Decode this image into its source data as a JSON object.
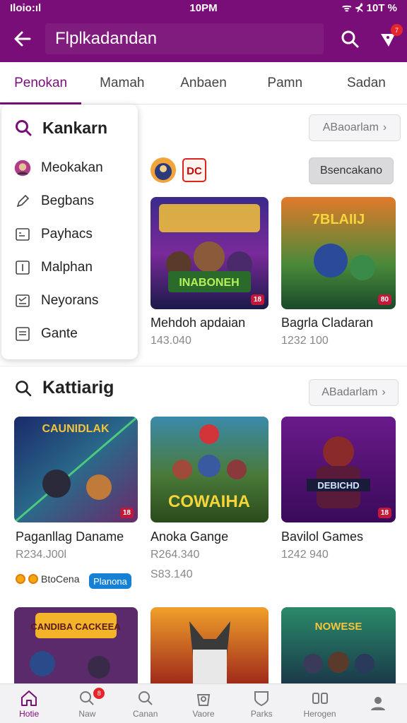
{
  "status_bar": {
    "left": "Iloio:ıl",
    "time": "10PM",
    "right": "ᯤ ⊀ 10T %"
  },
  "app_bar": {
    "title": "Flplkadandan",
    "cart_count": "7"
  },
  "tabs": [
    {
      "label": "Penokan",
      "active": true
    },
    {
      "label": "Mamah"
    },
    {
      "label": "Anbaen"
    },
    {
      "label": "Pamn"
    },
    {
      "label": "Sadan"
    }
  ],
  "dropdown": {
    "header": "Kankarn",
    "items": [
      {
        "label": "Meokakan",
        "icon": "avatar-icon"
      },
      {
        "label": "Begbans",
        "icon": "pencil-icon"
      },
      {
        "label": "Payhacs",
        "icon": "card-icon"
      },
      {
        "label": "Malphan",
        "icon": "bracket-icon"
      },
      {
        "label": "Neyorans",
        "icon": "checklist-icon"
      },
      {
        "label": "Gante",
        "icon": "document-icon"
      }
    ]
  },
  "top_section": {
    "see_all": "ABaoarlam",
    "action_button": "Bsencakano",
    "games": [
      {
        "name": "Mehdoh apdaian",
        "count": "143.040",
        "rating": "18",
        "art_text": "INABONEH"
      },
      {
        "name": "Bagrla Cladaran",
        "count": "1232 100",
        "rating": "80",
        "art_text": "7BLAIIJ"
      }
    ]
  },
  "section2": {
    "title": "Kattiarig",
    "see_all": "ABadarlam",
    "games": [
      {
        "name": "Paganllag Daname",
        "count": "R234.J00l",
        "rating": "18",
        "art_text": "CAUNIDLAK"
      },
      {
        "name": "Anoka Gange",
        "count": "R264.340",
        "count2": "S83.140",
        "art_text": "COWAIHA"
      },
      {
        "name": "Bavilol Games",
        "count": "1242 940",
        "rating": "18",
        "art_text": "DEBICHD"
      }
    ],
    "coin_text": "BtoCena",
    "tag": "Planona"
  },
  "third_row": [
    {
      "art_text": "CANDIBA CACKEEA"
    },
    {
      "art_text": ""
    },
    {
      "art_text": "NOWESE"
    }
  ],
  "bottom_nav": [
    {
      "label": "Hotie",
      "icon": "home-icon",
      "active": true
    },
    {
      "label": "Naw",
      "icon": "search-badge-icon",
      "badge": "8"
    },
    {
      "label": "Canan",
      "icon": "search-icon"
    },
    {
      "label": "Vaore",
      "icon": "bag-icon"
    },
    {
      "label": "Parks",
      "icon": "shield-icon"
    },
    {
      "label": "Herogen",
      "icon": "group-icon"
    },
    {
      "label": "",
      "icon": "profile-icon"
    }
  ],
  "colors": {
    "brand": "#7a0e78",
    "badge": "#e5252a",
    "rating": "#c2193a",
    "tag": "#1580d6"
  }
}
